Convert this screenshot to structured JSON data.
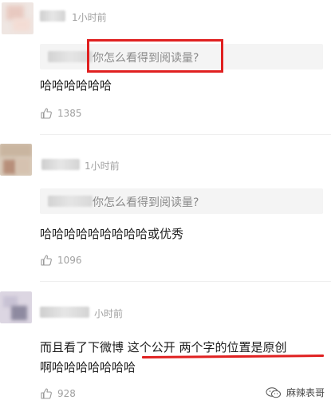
{
  "comments": [
    {
      "time": "1小时前",
      "quote": "你怎么看得到阅读量?",
      "text": "哈哈哈哈哈哈",
      "likes": "1385"
    },
    {
      "time": "1小时前",
      "quote": "你怎么看得到阅读量?",
      "text": "哈哈哈哈哈哈哈哈哈或优秀",
      "likes": "1096"
    },
    {
      "time": "小时前",
      "text_line1": "而且看了下微博 这个公开 两个字的位置是原创",
      "text_line2": "啊哈哈哈哈哈哈哈",
      "likes": "928"
    }
  ],
  "watermark": {
    "label": "麻辣表哥",
    "icon": "wechat-icon"
  },
  "colors": {
    "highlight": "#e02020",
    "muted": "#a0a0a0"
  }
}
